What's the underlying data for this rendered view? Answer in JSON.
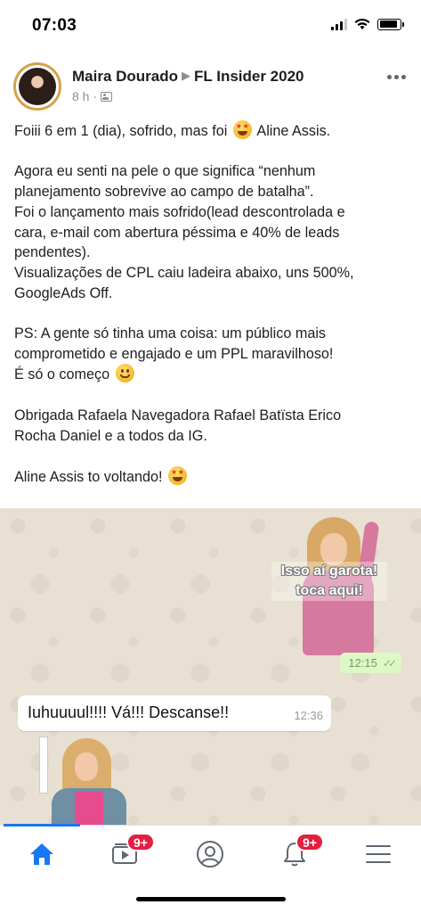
{
  "status_bar": {
    "time": "07:03",
    "battery_level": 0.9
  },
  "post": {
    "author": "Maira Dourado",
    "group": "FL Insider 2020",
    "time": "8 h",
    "lines": {
      "l1_a": "Foiii 6 em 1 (dia), sofrido, mas foi",
      "l1_b": "Aline Assis.",
      "l2": "Agora eu senti na pele o que significa “nenhum",
      "l3": "planejamento sobrevive ao campo de batalha”.",
      "l4": "Foi o lançamento mais sofrido(lead descontrolada e",
      "l5": "cara, e-mail com abertura péssima e 40% de leads",
      "l6": "pendentes).",
      "l7": "Visualizações de CPL caiu ladeira abaixo, uns 500%,",
      "l8": "GoogleAds Off.",
      "l9": "PS: A gente só tinha uma coisa: um público mais",
      "l10": "comprometido e engajado e um PPL maravilhoso!",
      "l11": "É só o começo",
      "l12": "Obrigada Rafaela Navegadora Rafael Batïsta Erico",
      "l13": "Rocha Daniel e a todos da IG.",
      "l14": "Aline Assis to voltando!"
    }
  },
  "chat": {
    "sticker_text_1": "Isso aí garota!",
    "sticker_text_2": "toca aqui!",
    "sent_time": "12:15",
    "message": "Iuhuuuul!!!! Vá!!! Descanse!!",
    "message_time": "12:36"
  },
  "nav": {
    "watch_badge": "9+",
    "notifications_badge": "9+",
    "active_color": "#1877f2",
    "icons": [
      "home-icon",
      "video-icon",
      "profile-icon",
      "bell-icon",
      "menu-icon"
    ]
  }
}
